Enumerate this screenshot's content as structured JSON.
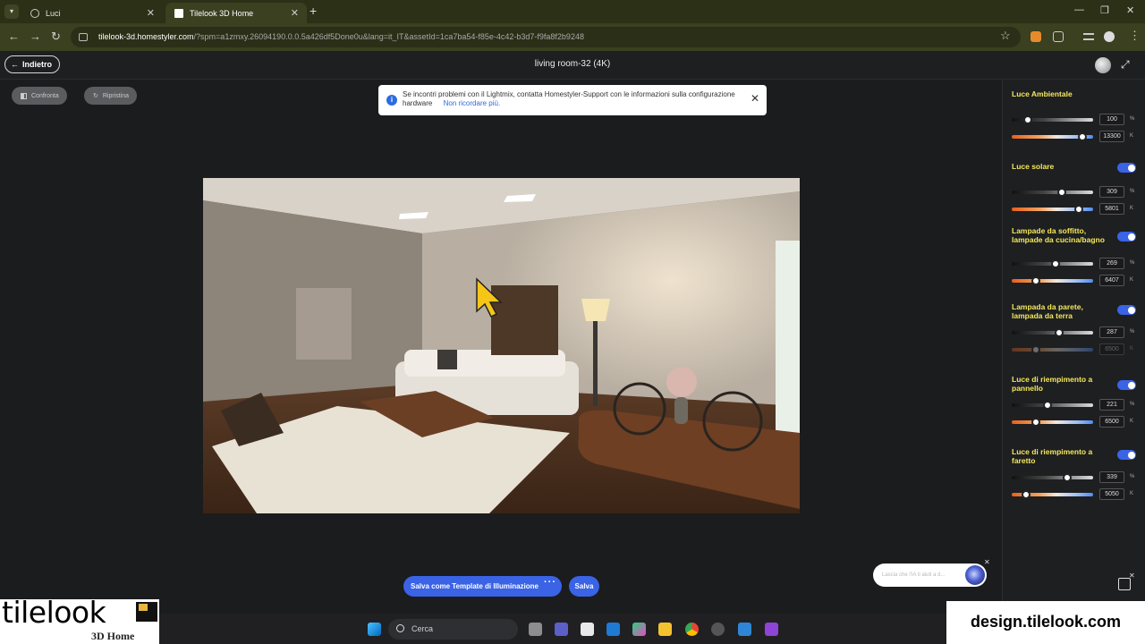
{
  "browser": {
    "tabs": [
      {
        "title": "Luci",
        "active": false
      },
      {
        "title": "Tilelook 3D Home",
        "active": true
      }
    ],
    "url_host": "tilelook-3d.homestyler.com",
    "url_path": "/?spm=a1zmxy.26094190.0.0.5a426df5Done0u&lang=it_IT&assetId=1ca7ba54-f85e-4c42-b3d7-f9fa8f2b9248"
  },
  "header": {
    "back_label": "Indietro",
    "scene_title": "living room-32 (4K)"
  },
  "toolbar": {
    "compare_label": "Confronta",
    "restore_label": "Ripristina"
  },
  "toast": {
    "message": "Se incontri problemi con il Lightmix, contatta Homestyler-Support con le informazioni sulla configurazione hardware",
    "link": "Non ricordare più."
  },
  "lights": [
    {
      "title": "Luce Ambientale",
      "toggle": false,
      "intensity": "100",
      "intensity_unit": "%",
      "intensity_level": 0.2,
      "temperature": "13300",
      "temperature_unit": "K",
      "temperature_level": 0.87,
      "dimmed": false
    },
    {
      "title": "Luce solare",
      "toggle": true,
      "intensity": "309",
      "intensity_unit": "%",
      "intensity_level": 0.62,
      "temperature": "5801",
      "temperature_unit": "K",
      "temperature_level": 0.82,
      "dimmed": false
    },
    {
      "title": "Lampade da soffitto, lampade da cucina/bagno",
      "toggle": true,
      "intensity": "269",
      "intensity_unit": "%",
      "intensity_level": 0.54,
      "temperature": "6407",
      "temperature_unit": "K",
      "temperature_level": 0.3,
      "dimmed": false
    },
    {
      "title": "Lampada da parete, lampada da terra",
      "toggle": true,
      "intensity": "287",
      "intensity_unit": "%",
      "intensity_level": 0.58,
      "temperature": "6500",
      "temperature_unit": "K",
      "temperature_level": 0.3,
      "dimmed": true
    },
    {
      "title": "Luce di riempimento a pannello",
      "toggle": true,
      "intensity": "221",
      "intensity_unit": "%",
      "intensity_level": 0.44,
      "temperature": "6500",
      "temperature_unit": "K",
      "temperature_level": 0.3,
      "dimmed": false
    },
    {
      "title": "Luce di riempimento a faretto",
      "toggle": true,
      "intensity": "339",
      "intensity_unit": "%",
      "intensity_level": 0.68,
      "temperature": "5050",
      "temperature_unit": "K",
      "temperature_level": 0.18,
      "dimmed": false
    }
  ],
  "actions": {
    "save_template_label": "Salva come Template di Illuminazione",
    "more_label": "···",
    "save_label": "Salva"
  },
  "ai_assistant": {
    "placeholder": "Lascia che l'IA ti aiuti a d..."
  },
  "watermark": {
    "logo_word": "tilelook",
    "logo_sub": "3D Home",
    "site": "design.tilelook.com"
  },
  "taskbar": {
    "search_label": "Cerca"
  },
  "colors": {
    "accent": "#3a63e6",
    "section_title": "#f4e95b",
    "tab_bar": "#2b3017"
  }
}
